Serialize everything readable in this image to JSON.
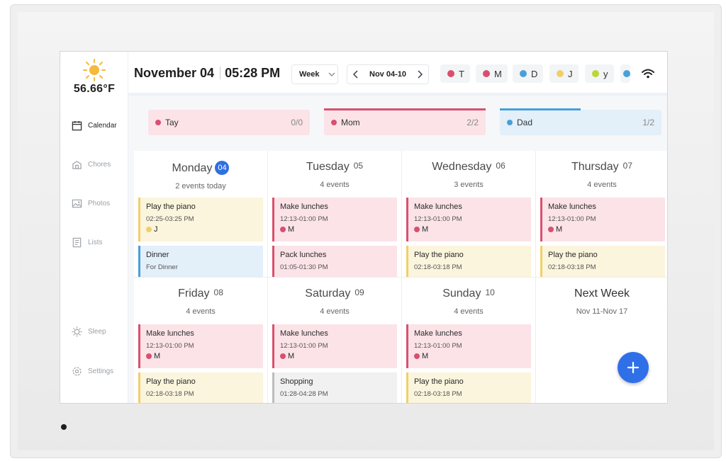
{
  "weather": {
    "temperature": "56.66°F",
    "icon": "sun-icon"
  },
  "sidebar": {
    "items": [
      {
        "label": "Calendar",
        "icon": "calendar-icon",
        "active": true
      },
      {
        "label": "Chores",
        "icon": "chores-icon"
      },
      {
        "label": "Photos",
        "icon": "photos-icon"
      },
      {
        "label": "Lists",
        "icon": "list-icon"
      },
      {
        "label": "Sleep",
        "icon": "sleep-icon"
      },
      {
        "label": "Settings",
        "icon": "gear-icon"
      }
    ]
  },
  "header": {
    "date": "November 04",
    "time": "05:28 PM",
    "view": "Week",
    "range": "Nov 04-10",
    "members": [
      {
        "initial": "T",
        "color": "#d9506e"
      },
      {
        "initial": "M",
        "color": "#d9506e"
      },
      {
        "initial": "D",
        "color": "#4a9fd8"
      },
      {
        "initial": "J",
        "color": "#f0cf6a"
      },
      {
        "initial": "y",
        "color": "#b9d63a"
      }
    ]
  },
  "summary": [
    {
      "name": "Tay",
      "count": "0/0",
      "color": "#d9506e",
      "bg": "#fbe3e8"
    },
    {
      "name": "Mom",
      "count": "2/2",
      "color": "#d9506e",
      "bg": "#fbe3e8"
    },
    {
      "name": "Dad",
      "count": "1/2",
      "color": "#4a9fd8",
      "bg": "#e3eff9"
    }
  ],
  "days": [
    {
      "name": "Monday",
      "num": "04",
      "today": true,
      "sub": "2 events today",
      "events": [
        {
          "title": "Play the piano",
          "time": "02:25-03:25 PM",
          "who": "J",
          "who_color": "#f0cf6a",
          "bg": "#fbf5dd",
          "border": "#f0cf6a"
        },
        {
          "title": "Dinner",
          "time": "For Dinner",
          "who": "",
          "who_color": "",
          "bg": "#e3eff9",
          "border": "#4a9fd8"
        }
      ]
    },
    {
      "name": "Tuesday",
      "num": "05",
      "sub": "4 events",
      "events": [
        {
          "title": "Make lunches",
          "time": "12:13-01:00 PM",
          "who": "M",
          "who_color": "#d9506e",
          "bg": "#fbe3e8",
          "border": "#d9506e"
        },
        {
          "title": "Pack lunches",
          "time": "01:05-01:30 PM",
          "who": "",
          "who_color": "",
          "bg": "#fbe3e8",
          "border": "#d9506e"
        }
      ]
    },
    {
      "name": "Wednesday",
      "num": "06",
      "sub": "3 events",
      "events": [
        {
          "title": "Make lunches",
          "time": "12:13-01:00 PM",
          "who": "M",
          "who_color": "#d9506e",
          "bg": "#fbe3e8",
          "border": "#d9506e"
        },
        {
          "title": "Play the piano",
          "time": "02:18-03:18 PM",
          "who": "",
          "who_color": "",
          "bg": "#fbf5dd",
          "border": "#f0cf6a"
        }
      ]
    },
    {
      "name": "Thursday",
      "num": "07",
      "sub": "4 events",
      "events": [
        {
          "title": "Make lunches",
          "time": "12:13-01:00 PM",
          "who": "M",
          "who_color": "#d9506e",
          "bg": "#fbe3e8",
          "border": "#d9506e"
        },
        {
          "title": "Play the piano",
          "time": "02:18-03:18 PM",
          "who": "",
          "who_color": "",
          "bg": "#fbf5dd",
          "border": "#f0cf6a"
        }
      ]
    },
    {
      "name": "Friday",
      "num": "08",
      "sub": "4 events",
      "events": [
        {
          "title": "Make lunches",
          "time": "12:13-01:00 PM",
          "who": "M",
          "who_color": "#d9506e",
          "bg": "#fbe3e8",
          "border": "#d9506e"
        },
        {
          "title": "Play the piano",
          "time": "02:18-03:18 PM",
          "who": "",
          "who_color": "",
          "bg": "#fbf5dd",
          "border": "#f0cf6a"
        }
      ]
    },
    {
      "name": "Saturday",
      "num": "09",
      "sub": "4 events",
      "events": [
        {
          "title": "Make lunches",
          "time": "12:13-01:00 PM",
          "who": "M",
          "who_color": "#d9506e",
          "bg": "#fbe3e8",
          "border": "#d9506e"
        },
        {
          "title": "Shopping",
          "time": "01:28-04:28 PM",
          "who": "",
          "who_color": "",
          "bg": "#f1f1f1",
          "border": "#bdbdbd"
        }
      ]
    },
    {
      "name": "Sunday",
      "num": "10",
      "sub": "4 events",
      "events": [
        {
          "title": "Make lunches",
          "time": "12:13-01:00 PM",
          "who": "M",
          "who_color": "#d9506e",
          "bg": "#fbe3e8",
          "border": "#d9506e"
        },
        {
          "title": "Play the piano",
          "time": "02:18-03:18 PM",
          "who": "",
          "who_color": "",
          "bg": "#fbf5dd",
          "border": "#f0cf6a"
        }
      ]
    }
  ],
  "next_week": {
    "title": "Next Week",
    "range": "Nov 11-Nov 17"
  }
}
